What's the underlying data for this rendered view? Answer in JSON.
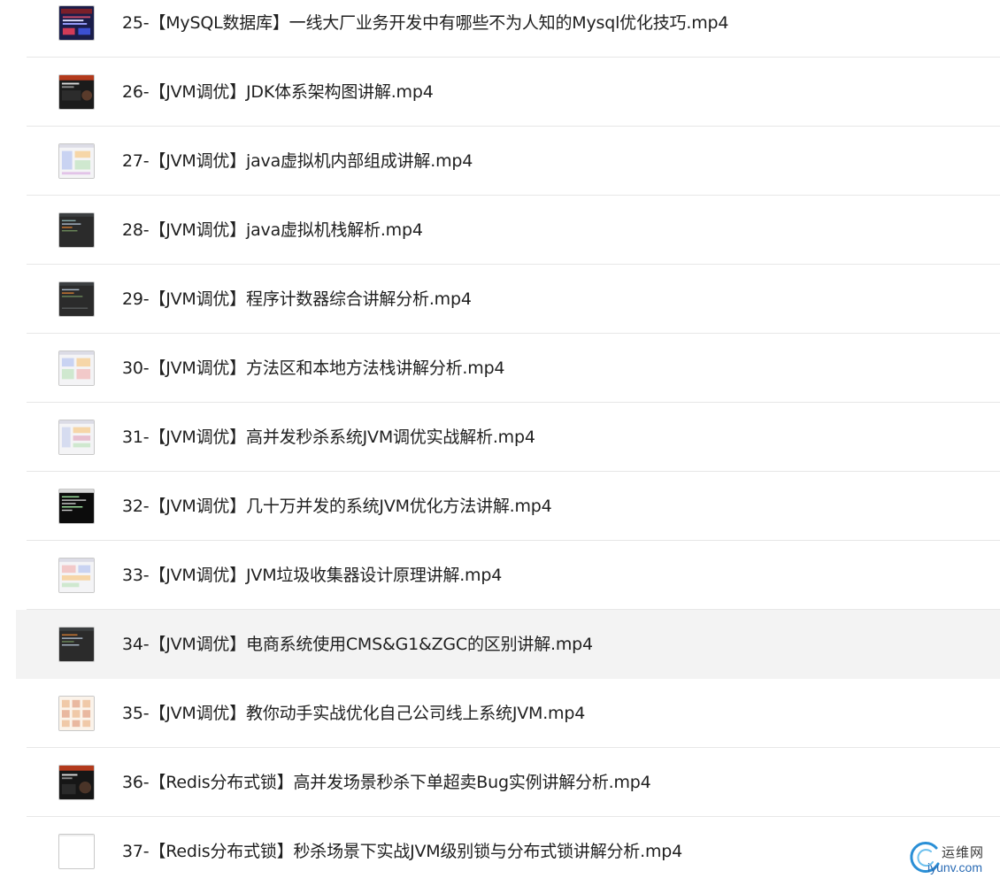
{
  "files": [
    {
      "name": "25-【MySQL数据库】一线大厂业务开发中有哪些不为人知的Mysql优化技巧.mp4",
      "thumbnail": "presentation-slide-thumbnail"
    },
    {
      "name": "26-【JVM调优】JDK体系架构图讲解.mp4",
      "thumbnail": "dark-slide-thumbnail"
    },
    {
      "name": "27-【JVM调优】java虚拟机内部组成讲解.mp4",
      "thumbnail": "diagram-thumbnail"
    },
    {
      "name": "28-【JVM调优】java虚拟机栈解析.mp4",
      "thumbnail": "code-editor-thumbnail"
    },
    {
      "name": "29-【JVM调优】程序计数器综合讲解分析.mp4",
      "thumbnail": "code-editor-thumbnail"
    },
    {
      "name": "30-【JVM调优】方法区和本地方法栈讲解分析.mp4",
      "thumbnail": "diagram-thumbnail"
    },
    {
      "name": "31-【JVM调优】高并发秒杀系统JVM调优实战解析.mp4",
      "thumbnail": "diagram-thumbnail"
    },
    {
      "name": "32-【JVM调优】几十万并发的系统JVM优化方法讲解.mp4",
      "thumbnail": "terminal-thumbnail"
    },
    {
      "name": "33-【JVM调优】JVM垃圾收集器设计原理讲解.mp4",
      "thumbnail": "diagram-thumbnail"
    },
    {
      "name": "34-【JVM调优】电商系统使用CMS&G1&ZGC的区别讲解.mp4",
      "thumbnail": "code-editor-thumbnail",
      "highlighted": true
    },
    {
      "name": "35-【JVM调优】教你动手实战优化自己公司线上系统JVM.mp4",
      "thumbnail": "grid-diagram-thumbnail"
    },
    {
      "name": "36-【Redis分布式锁】高并发场景秒杀下单超卖Bug实例讲解分析.mp4",
      "thumbnail": "dark-slide-thumbnail"
    },
    {
      "name": "37-【Redis分布式锁】秒杀场景下实战JVM级别锁与分布式锁讲解分析.mp4",
      "thumbnail": "blank-thumbnail"
    }
  ],
  "watermark": {
    "cn_text": "运维网",
    "en_text": "iyunv.com",
    "logo": "iyunv-logo-icon"
  },
  "colors": {
    "text": "#1f1f1f",
    "separator": "#e7e7e7",
    "highlight": "#f3f3f3",
    "watermark_blue": "#2a6bb4"
  }
}
